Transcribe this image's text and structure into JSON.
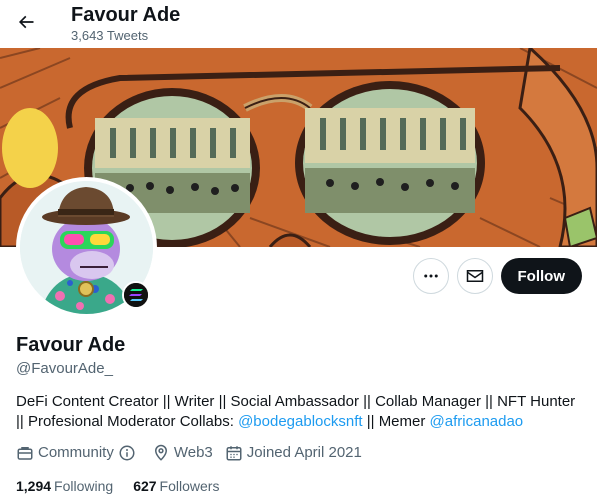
{
  "header": {
    "name": "Favour Ade",
    "tweet_count": "3,643 Tweets",
    "back_icon": "arrow-left-icon"
  },
  "banner": {
    "description_icon": "sunglasses-artwork",
    "colors": {
      "skin": "#c9682f",
      "outline": "#3a1f14",
      "lens": "#b0c7a5"
    }
  },
  "avatar": {
    "icon": "ape-avatar",
    "badge_icon": "solana-icon"
  },
  "actions": {
    "more_icon": "more-icon",
    "message_icon": "mail-icon",
    "follow_label": "Follow"
  },
  "profile": {
    "name": "Favour Ade",
    "handle": "@FavourAde_",
    "bio_line1": "DeFi Content Creator || Writer || Social Ambassador || Collab Manager || NFT Hunter",
    "bio_line2_prefix": "|| Profesional Moderator Collabs: ",
    "bio_link1": "@bodegablocksnft",
    "bio_mid": " || Memer ",
    "bio_link2": "@africanadao"
  },
  "meta": {
    "category": "Community",
    "location": "Web3",
    "joined": "Joined April 2021"
  },
  "stats": {
    "following_count": "1,294",
    "following_label": "Following",
    "followers_count": "627",
    "followers_label": "Followers"
  },
  "colors": {
    "text": "#0f1419",
    "secondary": "#536471",
    "link": "#1d9bf0",
    "follow_bg": "#0f1419"
  }
}
